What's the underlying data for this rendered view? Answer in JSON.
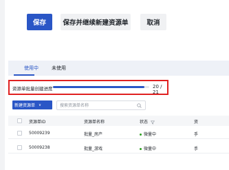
{
  "toolbar": {
    "save_label": "保存",
    "save_and_new_label": "保存并继续新建资源单",
    "cancel_label": "取消"
  },
  "tabs": [
    {
      "label": "使用中",
      "active": true
    },
    {
      "label": "未使用",
      "active": false
    }
  ],
  "progress": {
    "label": "资源单批量创建进度",
    "completed": 20,
    "total": 21,
    "fraction": 0.95,
    "count_text": "20 / 21"
  },
  "actions": {
    "new_button_label": "新建资源单",
    "search_placeholder": "搜索资源单名称"
  },
  "table": {
    "columns": [
      "资源单ID",
      "资源单名称",
      "状态",
      "资"
    ],
    "rows": [
      {
        "id": "50009239",
        "name": "批量_房产",
        "status": "微量中",
        "extra": "手"
      },
      {
        "id": "50009238",
        "name": "批量_游戏",
        "status": "微量中",
        "extra": "手"
      }
    ]
  },
  "colors": {
    "primary": "#2a56c6",
    "highlight_border": "#e02020",
    "status_green": "#2ea121"
  }
}
